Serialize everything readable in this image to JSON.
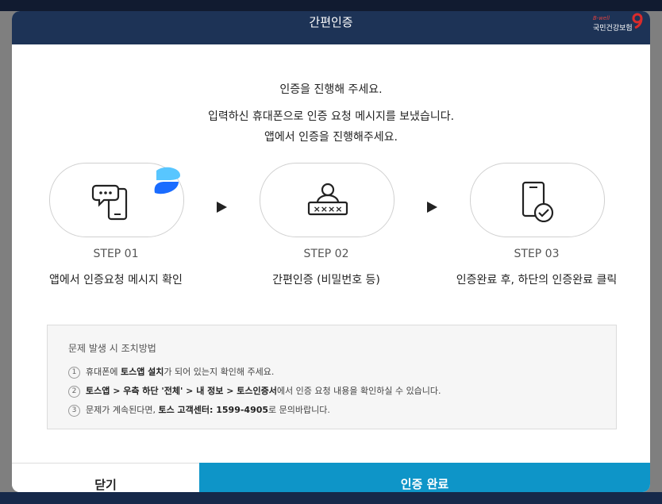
{
  "header": {
    "title": "간편인증",
    "brand_small": "B-well",
    "brand_name": "국민건강보험"
  },
  "intro": {
    "line1": "인증을 진행해 주세요.",
    "line2": "입력하신 휴대폰으로 인증 요청 메시지를 보냈습니다.",
    "line3": "앱에서 인증을 진행해주세요."
  },
  "steps": [
    {
      "label": "STEP 01",
      "desc": "앱에서 인증요청 메시지 확인",
      "icon": "phone-message-icon"
    },
    {
      "label": "STEP 02",
      "desc": "간편인증 (비밀번호 등)",
      "icon": "user-password-icon"
    },
    {
      "label": "STEP 03",
      "desc": "인증완료 후, 하단의 인증완료 클릭",
      "icon": "phone-check-icon"
    }
  ],
  "help": {
    "title": "문제 발생 시 조치방법",
    "items": [
      {
        "num": "1",
        "pre": "휴대폰에 ",
        "bold": "토스앱 설치",
        "post": "가 되어 있는지 확인해 주세요."
      },
      {
        "num": "2",
        "pre": "",
        "bold": "토스앱 > 우측 하단 '전체' > 내 정보 > 토스인증서",
        "post": "에서 인증 요청 내용을 확인하실 수 있습니다."
      },
      {
        "num": "3",
        "pre": "문제가 계속된다면, ",
        "bold": "토스 고객센터: 1599-4905",
        "post": "로 문의바랍니다."
      }
    ]
  },
  "buttons": {
    "close": "닫기",
    "done": "인증 완료"
  },
  "colors": {
    "header_bg": "#1d3356",
    "primary_button": "#0e95c8",
    "toss_blue": "#1a6cff"
  }
}
